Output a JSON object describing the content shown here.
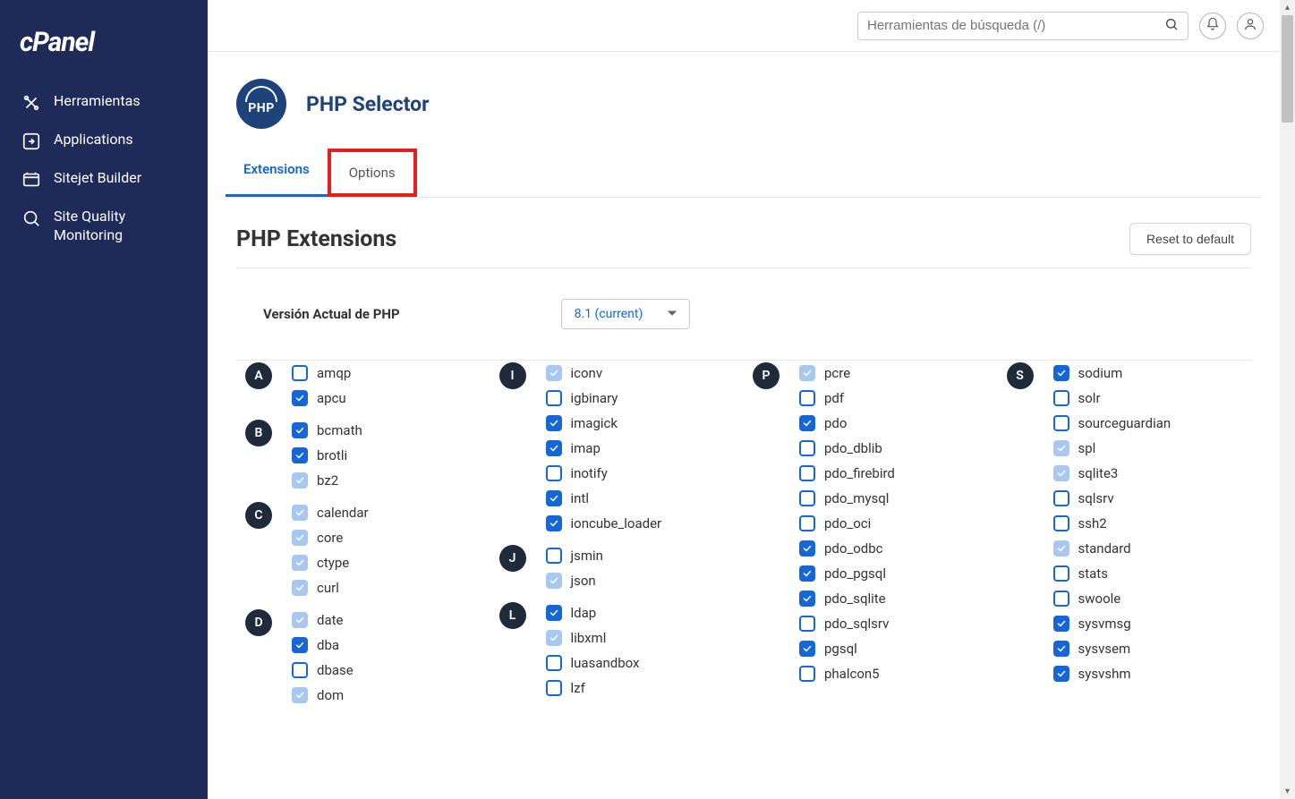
{
  "brand": "cPanel",
  "sidebar": {
    "items": [
      {
        "label": "Herramientas",
        "icon": "tools"
      },
      {
        "label": "Applications",
        "icon": "app"
      },
      {
        "label": "Sitejet Builder",
        "icon": "builder"
      },
      {
        "label": "Site Quality Monitoring",
        "icon": "monitor"
      }
    ]
  },
  "search": {
    "placeholder": "Herramientas de búsqueda (/)"
  },
  "page": {
    "title": "PHP Selector",
    "badge": "PHP"
  },
  "tabs": {
    "extensions": "Extensions",
    "options": "Options"
  },
  "section": {
    "title": "PHP Extensions",
    "reset": "Reset to default"
  },
  "version": {
    "label": "Versión Actual de PHP",
    "value": "8.1 (current)"
  },
  "extensions": {
    "col1": [
      {
        "letter": "A",
        "items": [
          {
            "name": "amqp",
            "state": "unchecked"
          },
          {
            "name": "apcu",
            "state": "checked"
          }
        ]
      },
      {
        "letter": "B",
        "items": [
          {
            "name": "bcmath",
            "state": "checked"
          },
          {
            "name": "brotli",
            "state": "checked"
          },
          {
            "name": "bz2",
            "state": "locked"
          }
        ]
      },
      {
        "letter": "C",
        "items": [
          {
            "name": "calendar",
            "state": "locked"
          },
          {
            "name": "core",
            "state": "locked"
          },
          {
            "name": "ctype",
            "state": "locked"
          },
          {
            "name": "curl",
            "state": "locked"
          }
        ]
      },
      {
        "letter": "D",
        "items": [
          {
            "name": "date",
            "state": "locked"
          },
          {
            "name": "dba",
            "state": "checked"
          },
          {
            "name": "dbase",
            "state": "unchecked"
          },
          {
            "name": "dom",
            "state": "locked"
          }
        ]
      }
    ],
    "col2": [
      {
        "letter": "I",
        "items": [
          {
            "name": "iconv",
            "state": "locked"
          },
          {
            "name": "igbinary",
            "state": "unchecked"
          },
          {
            "name": "imagick",
            "state": "checked"
          },
          {
            "name": "imap",
            "state": "checked"
          },
          {
            "name": "inotify",
            "state": "unchecked"
          },
          {
            "name": "intl",
            "state": "checked"
          },
          {
            "name": "ioncube_loader",
            "state": "checked"
          }
        ]
      },
      {
        "letter": "J",
        "items": [
          {
            "name": "jsmin",
            "state": "unchecked"
          },
          {
            "name": "json",
            "state": "locked"
          }
        ]
      },
      {
        "letter": "L",
        "items": [
          {
            "name": "ldap",
            "state": "checked"
          },
          {
            "name": "libxml",
            "state": "locked"
          },
          {
            "name": "luasandbox",
            "state": "unchecked"
          },
          {
            "name": "lzf",
            "state": "unchecked"
          }
        ]
      }
    ],
    "col3": [
      {
        "letter": "P",
        "items": [
          {
            "name": "pcre",
            "state": "locked"
          },
          {
            "name": "pdf",
            "state": "unchecked"
          },
          {
            "name": "pdo",
            "state": "checked"
          },
          {
            "name": "pdo_dblib",
            "state": "unchecked"
          },
          {
            "name": "pdo_firebird",
            "state": "unchecked"
          },
          {
            "name": "pdo_mysql",
            "state": "unchecked"
          },
          {
            "name": "pdo_oci",
            "state": "unchecked"
          },
          {
            "name": "pdo_odbc",
            "state": "checked"
          },
          {
            "name": "pdo_pgsql",
            "state": "checked"
          },
          {
            "name": "pdo_sqlite",
            "state": "checked"
          },
          {
            "name": "pdo_sqlsrv",
            "state": "unchecked"
          },
          {
            "name": "pgsql",
            "state": "checked"
          },
          {
            "name": "phalcon5",
            "state": "unchecked"
          }
        ]
      }
    ],
    "col4": [
      {
        "letter": "S",
        "items": [
          {
            "name": "sodium",
            "state": "checked"
          },
          {
            "name": "solr",
            "state": "unchecked"
          },
          {
            "name": "sourceguardian",
            "state": "unchecked"
          },
          {
            "name": "spl",
            "state": "locked"
          },
          {
            "name": "sqlite3",
            "state": "locked"
          },
          {
            "name": "sqlsrv",
            "state": "unchecked"
          },
          {
            "name": "ssh2",
            "state": "unchecked"
          },
          {
            "name": "standard",
            "state": "locked"
          },
          {
            "name": "stats",
            "state": "unchecked"
          },
          {
            "name": "swoole",
            "state": "unchecked"
          },
          {
            "name": "sysvmsg",
            "state": "checked"
          },
          {
            "name": "sysvsem",
            "state": "checked"
          },
          {
            "name": "sysvshm",
            "state": "checked"
          }
        ]
      }
    ]
  }
}
